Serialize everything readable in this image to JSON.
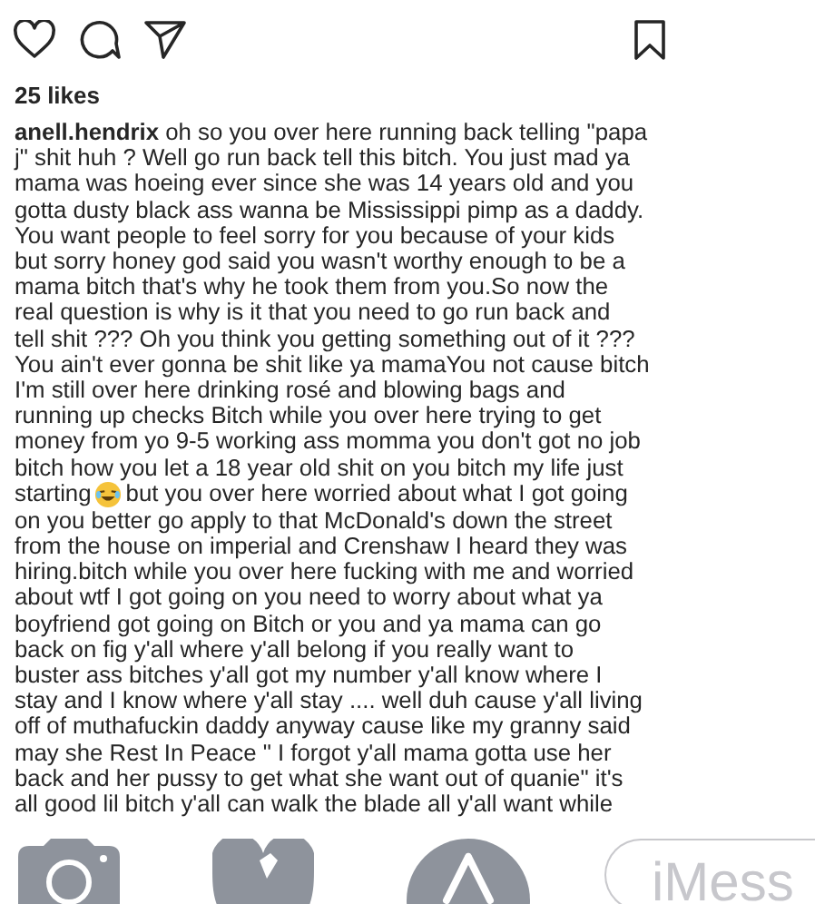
{
  "post": {
    "likes": "25 likes",
    "caption": [
      {
        "kind": "text",
        "text": "**anell.hendrix** oh so you over here running back telling \"papa"
      },
      {
        "kind": "text",
        "text": "j\" shit huh ? Well go run back tell this bitch. You just mad ya"
      },
      {
        "kind": "text",
        "text": "mama was hoeing ever since she was 14 years old and you"
      },
      {
        "kind": "text",
        "text": "gotta dusty black ass wanna be Mississippi pimp as a daddy."
      },
      {
        "kind": "text",
        "text": "You want people to feel sorry for you because of your kids"
      },
      {
        "kind": "text",
        "text": "but sorry honey god said you wasn't worthy enough to be a"
      },
      {
        "kind": "text",
        "text": "mama bitch that's why he took them from you.So now the"
      },
      {
        "kind": "text",
        "text": "real question is why is it that you need to go run back and"
      },
      {
        "kind": "text",
        "text": "tell shit ??? Oh you think you getting something out of it ???"
      },
      {
        "kind": "text",
        "text": "You ain't ever gonna be shit like ya mamaYou not cause bitch"
      },
      {
        "kind": "text",
        "text": "I'm still over here drinking rosé and blowing bags and"
      },
      {
        "kind": "text",
        "text": "running up checks Bitch while you over here trying to get"
      },
      {
        "kind": "text",
        "text": "money from yo 9-5 working ass momma you don't got no job"
      },
      {
        "kind": "text",
        "text": "bitch how you let a 18 year old shit on you bitch my life just"
      },
      {
        "kind": "emoji",
        "before": "starting",
        "after": "but you over here worried about what I got going"
      },
      {
        "kind": "text",
        "text": "on you better go apply to that McDonald's down the street"
      },
      {
        "kind": "text",
        "text": "from the house on imperial and Crenshaw I heard they was"
      },
      {
        "kind": "text",
        "text": "hiring.bitch while you over here fucking with me and worried"
      },
      {
        "kind": "text",
        "text": "about wtf I got going on you need to worry about what ya"
      },
      {
        "kind": "text",
        "text": "boyfriend got going on Bitch or you and ya mama can go"
      },
      {
        "kind": "text",
        "text": "back on fig y'all where y'all belong if you really want to"
      },
      {
        "kind": "text",
        "text": "buster ass bitches y'all got my number y'all know where I"
      },
      {
        "kind": "text",
        "text": "stay and I know where y'all stay .... well duh cause y'all living"
      },
      {
        "kind": "text",
        "text": "off of muthafuckin daddy anyway cause like my granny said"
      },
      {
        "kind": "text",
        "text": "may she Rest In Peace \" I forgot y'all mama gotta use her"
      },
      {
        "kind": "text",
        "text": "back and her pussy to get what she want out of quanie\" it's"
      },
      {
        "kind": "text",
        "text": "all good lil bitch y'all can walk the blade all y'all want while"
      }
    ]
  },
  "message_bar": {
    "placeholder": "iMess"
  }
}
